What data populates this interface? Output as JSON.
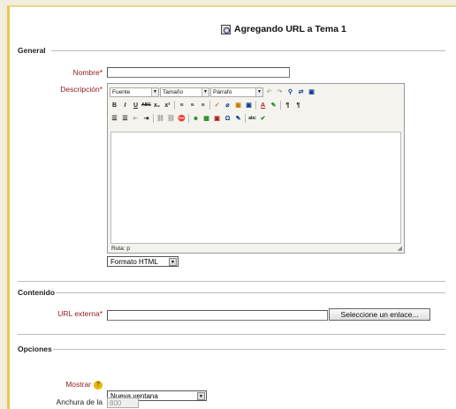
{
  "page": {
    "title": "Agregando URL a Tema 1",
    "title_icon": "link-page-icon"
  },
  "colors": {
    "label": "#8b1c1c",
    "required": "#dd0000",
    "frame_accent": "#e9c84a",
    "help": "#e8b800"
  },
  "sections": {
    "general": "General",
    "contenido": "Contenido",
    "opciones": "Opciones"
  },
  "fields": {
    "nombre": {
      "label": "Nombre",
      "required": "*",
      "value": ""
    },
    "descripcion": {
      "label": "Descripción",
      "required": "*"
    },
    "url": {
      "label": "URL externa",
      "required": "*",
      "value": "",
      "button": "Seleccione un enlace..."
    },
    "mostrar": {
      "label": "Mostrar",
      "value": "Nueva ventana",
      "help_icon": "help-icon"
    },
    "anchura": {
      "label": "Anchura de la",
      "value": "800"
    }
  },
  "editor": {
    "font_select": "Fuente",
    "size_select": "Tamaño",
    "format_select": "Párrafo",
    "path": "Ruta: p",
    "format_type": "Formato HTML",
    "row2": [
      "B",
      "I",
      "U",
      "ABC",
      "x₂",
      "x²"
    ],
    "row2b": [
      "≡",
      "≡",
      "≡",
      "✓",
      "⌀",
      "▣",
      "▣",
      "A",
      "✎",
      "¶",
      "¶"
    ],
    "row3": [
      "☰",
      "☰",
      "⇤",
      "⇥",
      "⛓",
      "⛓",
      "⛔",
      "☻",
      "▦",
      "▣",
      "Ω",
      "✎",
      "abc",
      "✔"
    ]
  }
}
